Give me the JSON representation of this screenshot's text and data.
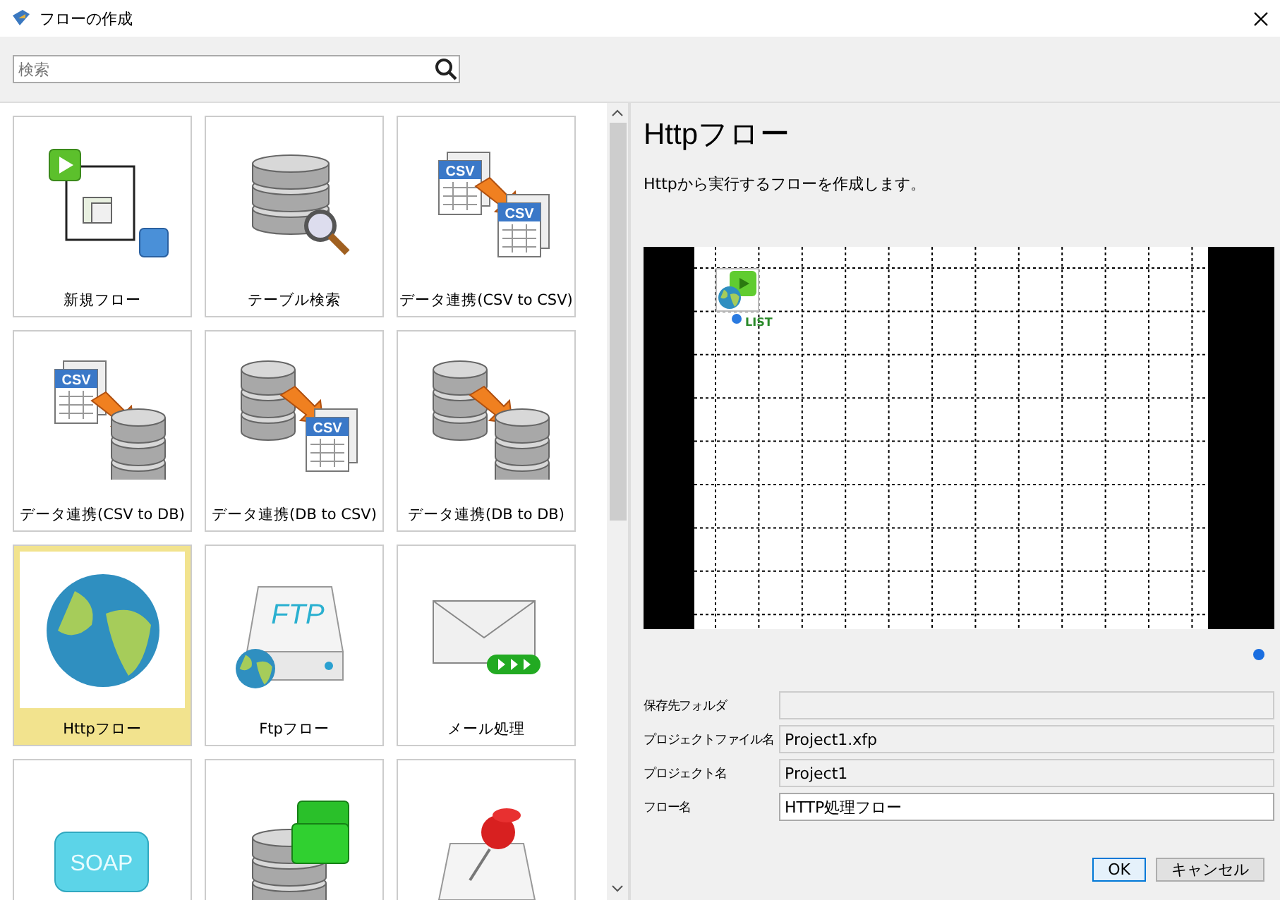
{
  "window": {
    "title": "フローの作成"
  },
  "search": {
    "placeholder": "検索"
  },
  "tiles": [
    {
      "kind": "flow",
      "label": "新規フロー",
      "selected": false
    },
    {
      "kind": "db-search",
      "label": "テーブル検索",
      "selected": false
    },
    {
      "kind": "csv-csv",
      "label": "データ連携(CSV to CSV)",
      "selected": false,
      "icon_labels": [
        "CSV",
        "CSV"
      ]
    },
    {
      "kind": "csv-db",
      "label": "データ連携(CSV to DB)",
      "selected": false,
      "icon_labels": [
        "CSV"
      ]
    },
    {
      "kind": "db-csv",
      "label": "データ連携(DB to CSV)",
      "selected": false,
      "icon_labels": [
        "CSV"
      ]
    },
    {
      "kind": "db-db",
      "label": "データ連携(DB to DB)",
      "selected": false
    },
    {
      "kind": "globe",
      "label": "Httpフロー",
      "selected": true
    },
    {
      "kind": "ftp",
      "label": "Ftpフロー",
      "selected": false,
      "icon_labels": [
        "FTP"
      ]
    },
    {
      "kind": "mail",
      "label": "メール処理",
      "selected": false
    },
    {
      "kind": "soap",
      "selected": false,
      "icon_labels": [
        "SOAP"
      ]
    },
    {
      "kind": "db-docs",
      "selected": false
    },
    {
      "kind": "pin",
      "selected": false
    }
  ],
  "detail": {
    "title": "Httpフロー",
    "description": "Httpから実行するフローを作成します。",
    "preview_node_label": "LIST"
  },
  "form": [
    {
      "label": "保存先フォルダ",
      "editable": false
    },
    {
      "label": "プロジェクトファイル名",
      "value": "Project1.xfp",
      "editable": false
    },
    {
      "label": "プロジェクト名",
      "value": "Project1",
      "editable": false
    },
    {
      "label": "フロー名",
      "value": "HTTP処理フロー",
      "editable": true
    }
  ],
  "buttons": [
    {
      "label": "OK",
      "default": true
    },
    {
      "label": "キャンセル",
      "default": false
    }
  ]
}
